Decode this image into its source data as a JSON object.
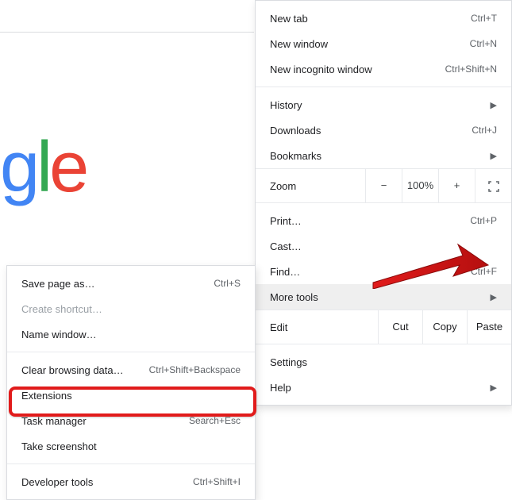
{
  "logo": {
    "g": "g",
    "l": "l",
    "e": "e"
  },
  "main_menu": {
    "new_tab": {
      "label": "New tab",
      "shortcut": "Ctrl+T"
    },
    "new_window": {
      "label": "New window",
      "shortcut": "Ctrl+N"
    },
    "incognito": {
      "label": "New incognito window",
      "shortcut": "Ctrl+Shift+N"
    },
    "history": {
      "label": "History"
    },
    "downloads": {
      "label": "Downloads",
      "shortcut": "Ctrl+J"
    },
    "bookmarks": {
      "label": "Bookmarks"
    },
    "zoom": {
      "label": "Zoom",
      "minus": "−",
      "value": "100%",
      "plus": "+",
      "full": "⛶"
    },
    "print": {
      "label": "Print…",
      "shortcut": "Ctrl+P"
    },
    "cast": {
      "label": "Cast…"
    },
    "find": {
      "label": "Find…",
      "shortcut": "Ctrl+F"
    },
    "more_tools": {
      "label": "More tools"
    },
    "edit": {
      "label": "Edit",
      "cut": "Cut",
      "copy": "Copy",
      "paste": "Paste"
    },
    "settings": {
      "label": "Settings"
    },
    "help": {
      "label": "Help"
    }
  },
  "sub_menu": {
    "save_page": {
      "label": "Save page as…",
      "shortcut": "Ctrl+S"
    },
    "create_shortcut": {
      "label": "Create shortcut…"
    },
    "name_window": {
      "label": "Name window…"
    },
    "clear_browsing": {
      "label": "Clear browsing data…",
      "shortcut": "Ctrl+Shift+Backspace"
    },
    "extensions": {
      "label": "Extensions"
    },
    "task_manager": {
      "label": "Task manager",
      "shortcut": "Search+Esc"
    },
    "take_screenshot": {
      "label": "Take screenshot"
    },
    "developer_tools": {
      "label": "Developer tools",
      "shortcut": "Ctrl+Shift+I"
    }
  }
}
